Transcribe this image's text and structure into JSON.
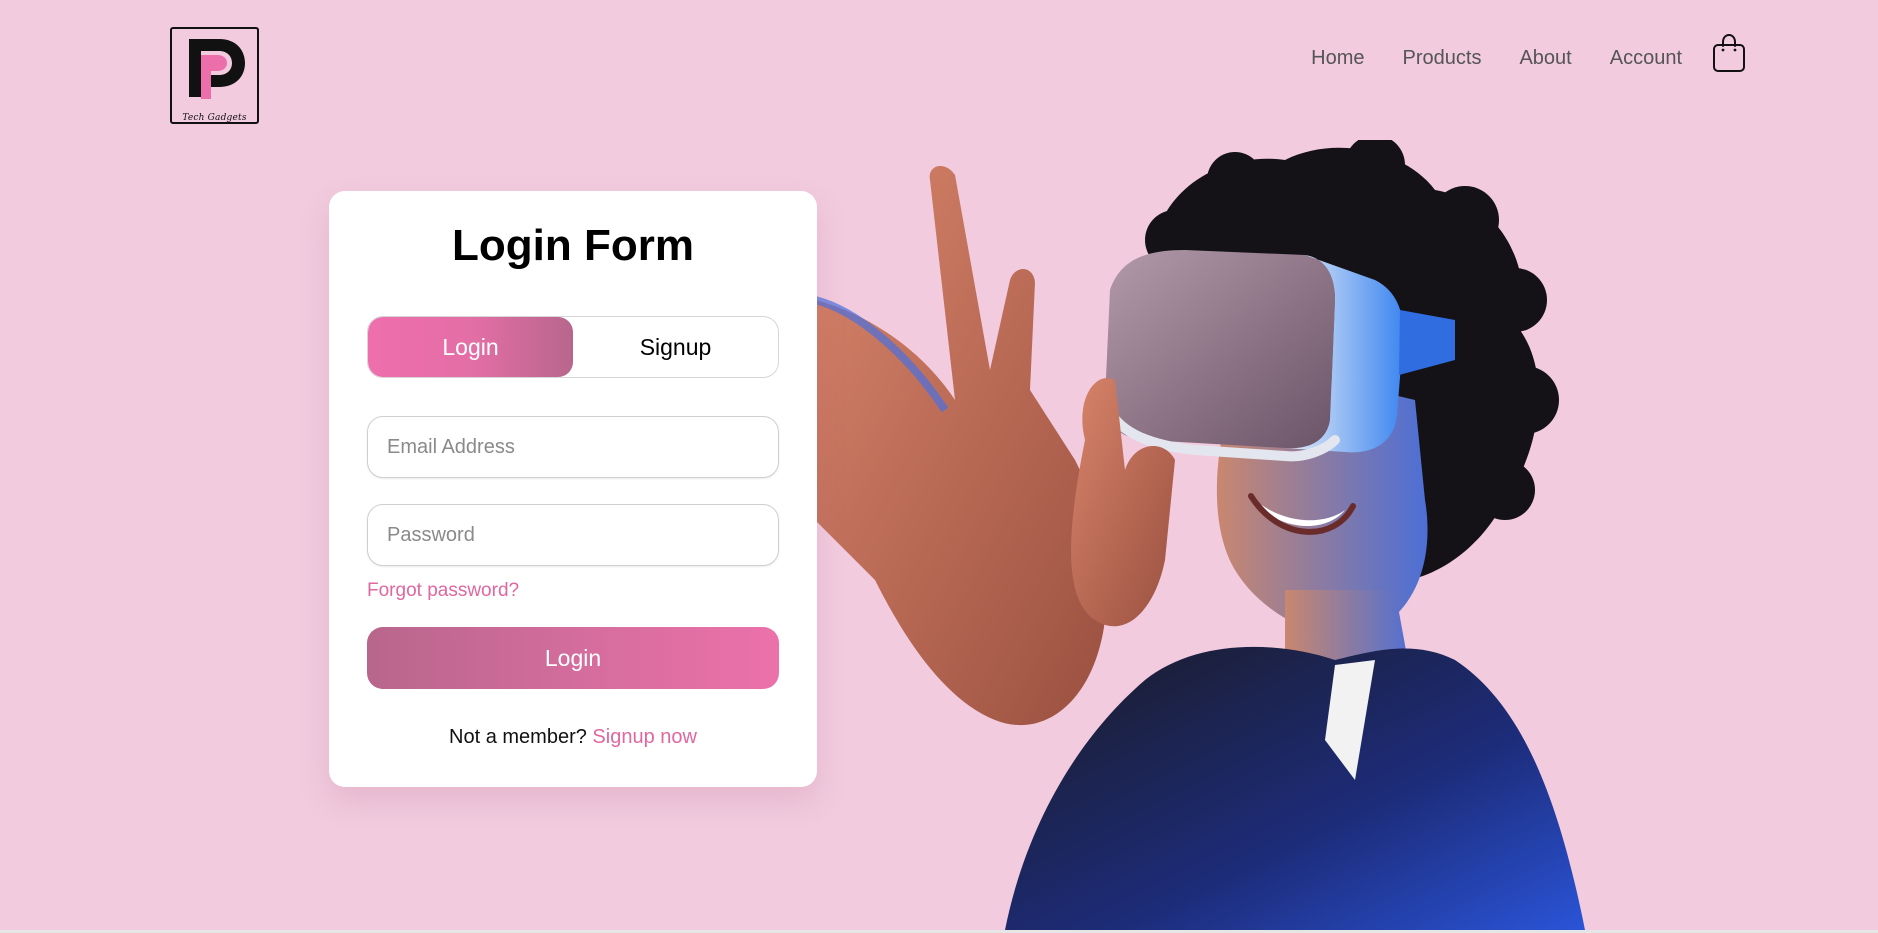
{
  "brand": {
    "logo_letter_mark": "P",
    "tagline": "Tech Gadgets"
  },
  "nav": {
    "items": [
      {
        "label": "Home"
      },
      {
        "label": "Products"
      },
      {
        "label": "About"
      },
      {
        "label": "Account"
      }
    ],
    "cart_icon": "shopping-bag-icon"
  },
  "login_card": {
    "title": "Login Form",
    "tabs": [
      {
        "label": "Login",
        "active": true
      },
      {
        "label": "Signup",
        "active": false
      }
    ],
    "email": {
      "value": "",
      "placeholder": "Email Address"
    },
    "password": {
      "value": "",
      "placeholder": "Password"
    },
    "forgot_link": "Forgot password?",
    "submit_label": "Login",
    "footer_text": "Not a member?",
    "footer_link": "Signup now"
  },
  "hero": {
    "image": "woman-wearing-vr-headset"
  },
  "colors": {
    "page_background": "#f2cbde",
    "accent_pink": "#e0679f",
    "gradient_light": "#ee6fac",
    "gradient_dark": "#b8668c",
    "card_background": "#ffffff"
  }
}
